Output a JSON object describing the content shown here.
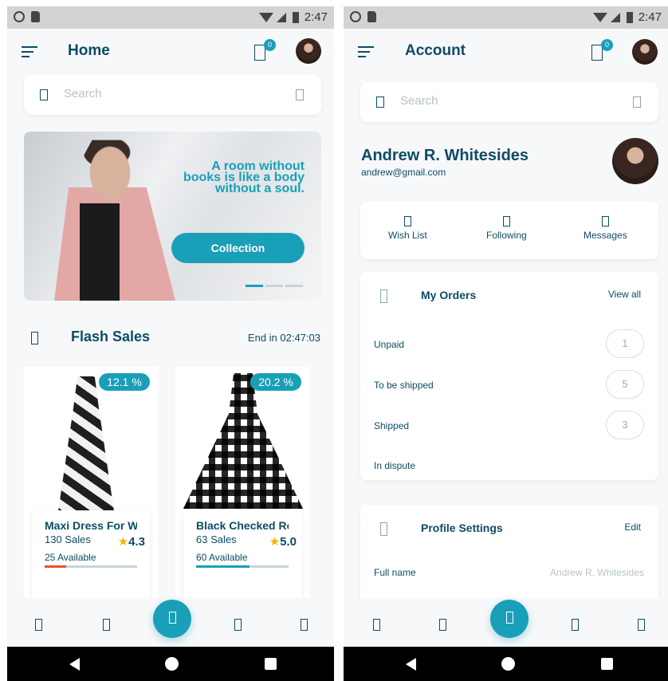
{
  "status_bar": {
    "time": "2:47"
  },
  "home": {
    "header": {
      "title": "Home",
      "cart_badge": "0"
    },
    "search": {
      "placeholder": "Search"
    },
    "banner": {
      "quote_line1": "A room without",
      "quote_line2": "books is like a body",
      "quote_line3": "without a soul.",
      "button_label": "Collection"
    },
    "flash_sales": {
      "title": "Flash Sales",
      "timer": "End in 02:47:03"
    },
    "products": [
      {
        "discount": "12.1 %",
        "name": "Maxi Dress For W",
        "sales": "130 Sales",
        "rating": "4.3",
        "available": "25 Available",
        "progress": 0.23,
        "progress_color": "#e8532b"
      },
      {
        "discount": "20.2 %",
        "name": "Black Checked Re",
        "sales": "63 Sales",
        "rating": "5.0",
        "available": "60 Available",
        "progress": 0.58,
        "progress_color": "#1a9fb8"
      }
    ]
  },
  "account": {
    "header": {
      "title": "Account",
      "cart_badge": "0"
    },
    "search": {
      "placeholder": "Search"
    },
    "profile": {
      "name": "Andrew R. Whitesides",
      "email": "andrew@gmail.com"
    },
    "quick_links": [
      {
        "label": "Wish List",
        "icon": "heart-icon"
      },
      {
        "label": "Following",
        "icon": "user-follow-icon"
      },
      {
        "label": "Messages",
        "icon": "message-icon"
      }
    ],
    "orders": {
      "title": "My Orders",
      "action": "View all",
      "rows": [
        {
          "label": "Unpaid",
          "count": "1"
        },
        {
          "label": "To be shipped",
          "count": "5"
        },
        {
          "label": "Shipped",
          "count": "3"
        },
        {
          "label": "In dispute"
        }
      ]
    },
    "settings": {
      "title": "Profile Settings",
      "action": "Edit",
      "full_name_label": "Full name",
      "full_name_value": "Andrew R. Whitesides"
    }
  },
  "colors": {
    "accent": "#1a9fb8",
    "primary_text": "#0e4b66",
    "muted_text": "#b6c3cb"
  }
}
